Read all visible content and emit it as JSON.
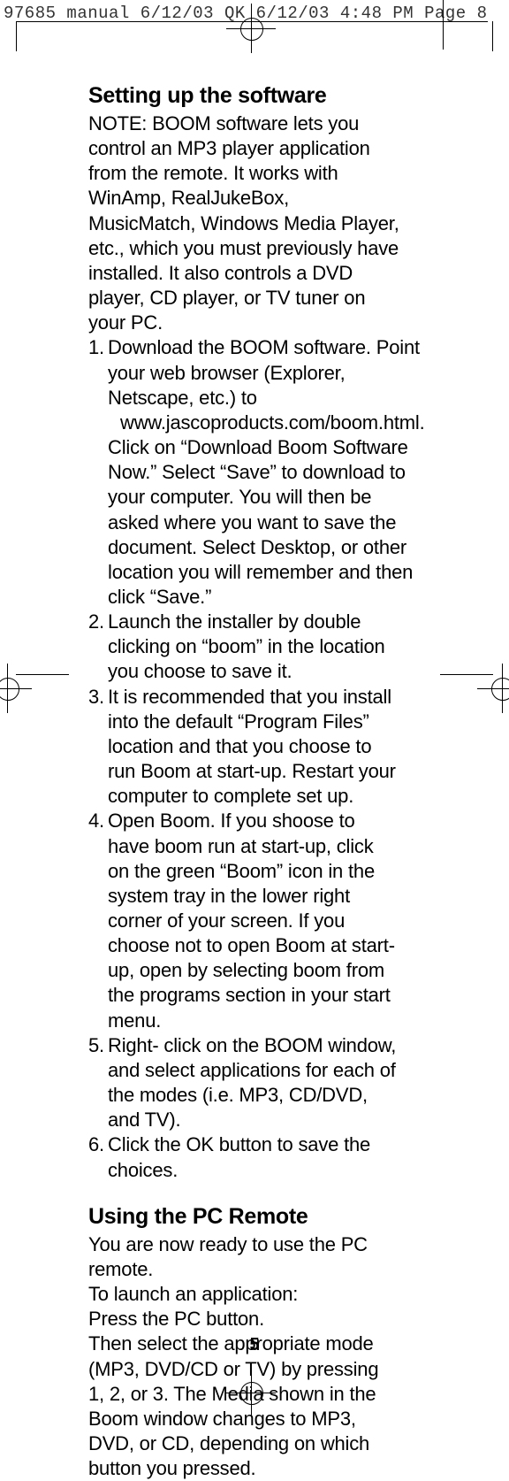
{
  "header": "97685 manual 6/12/03 QK  6/12/03  4:48 PM  Page 8",
  "page_number": "5",
  "section1": {
    "title": "Setting up the software",
    "note": "NOTE: BOOM software lets you control an MP3 player application from the remote. It works with WinAmp, RealJukeBox, MusicMatch, Windows Media Player, etc., which you must pre­viously have installed. It also controls a DVD player, CD player, or TV tuner on your PC.",
    "steps": [
      {
        "n": "1.",
        "a": "Download the BOOM software. Point your web browser (Explorer, Netscape, etc.) to",
        "url": "www.jascoproducts.com/boom.html.",
        "b": "Click on “Download Boom Software Now.” Select “Save” to download to your computer. You will then be asked where you want to save the docu­ment. Select Desktop, or other loca­tion you will remember and then click “Save.”"
      },
      {
        "n": "2.",
        "a": "Launch the installer by double click­ing on “boom” in the location you choose to save it."
      },
      {
        "n": "3.",
        "a": "It is recommended that you install into the default “Program Files” loca­tion and that you choose to run Boom at start-up. Restart your computer to complete set up."
      },
      {
        "n": "4.",
        "a": "Open Boom. If you shoose to have boom run at start-up, click on the green “Boom” icon in the system tray in the lower right corner of your screen. If you choose not to open Boom at start-up, open by selecting boom from the programs section in your start menu."
      },
      {
        "n": "5.",
        "a": "Right- click on the BOOM window, and select applications for each of the modes (i.e. MP3, CD/DVD, and TV)."
      },
      {
        "n": "6.",
        "a": "Click the OK button to save the choices."
      }
    ]
  },
  "section2": {
    "title": "Using the PC Remote",
    "lines": [
      "You are now ready to use the PC remote.",
      "To launch an application:",
      "Press the PC button.",
      "Then select the appropriate mode (MP3, DVD/CD or TV) by pressing 1, 2, or 3. The Media shown in the Boom window changes to MP3, DVD, or CD, depending on which button you pressed."
    ]
  }
}
